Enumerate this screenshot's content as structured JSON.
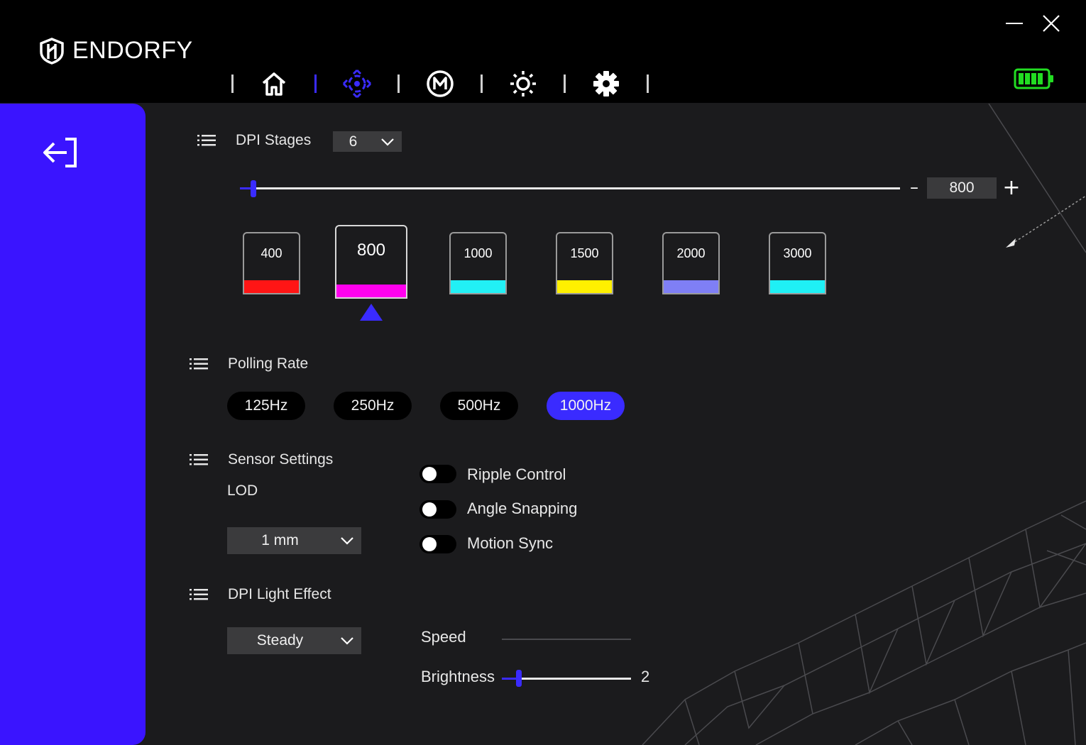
{
  "app": {
    "brand": "ENDORFY"
  },
  "nav": {
    "tabs": [
      {
        "name": "home",
        "icon": "home-icon",
        "active": false
      },
      {
        "name": "performance",
        "icon": "crosshair-icon",
        "active": true
      },
      {
        "name": "macro",
        "icon": "macro-m-icon",
        "active": false
      },
      {
        "name": "lighting",
        "icon": "sun-icon",
        "active": false
      },
      {
        "name": "settings",
        "icon": "gear-icon",
        "active": false
      }
    ]
  },
  "colors": {
    "accent": "#3a2bff",
    "sidebar": "#3a14ff",
    "battery": "#22dd22"
  },
  "dpi": {
    "title": "DPI Stages",
    "stage_count": "6",
    "current_value": "800",
    "minus": "–",
    "plus": "+",
    "slider_level": 0.02,
    "stages": [
      {
        "value": "400",
        "color": "#ff1515"
      },
      {
        "value": "800",
        "color": "#ff00ee",
        "selected": true
      },
      {
        "value": "1000",
        "color": "#22f0f5"
      },
      {
        "value": "1500",
        "color": "#fff000"
      },
      {
        "value": "2000",
        "color": "#7f7ff5"
      },
      {
        "value": "3000",
        "color": "#1ff0f5"
      }
    ]
  },
  "polling": {
    "title": "Polling Rate",
    "options": [
      "125Hz",
      "250Hz",
      "500Hz",
      "1000Hz"
    ],
    "selected": "1000Hz"
  },
  "sensor": {
    "title": "Sensor Settings",
    "lod_label": "LOD",
    "lod_value": "1 mm",
    "toggles": [
      {
        "label": "Ripple Control",
        "on": false
      },
      {
        "label": "Angle Snapping",
        "on": false
      },
      {
        "label": "Motion Sync",
        "on": false
      }
    ]
  },
  "light": {
    "title": "DPI Light Effect",
    "mode": "Steady",
    "speed_label": "Speed",
    "brightness_label": "Brightness",
    "brightness_value": "2",
    "brightness_level": 0.13
  }
}
